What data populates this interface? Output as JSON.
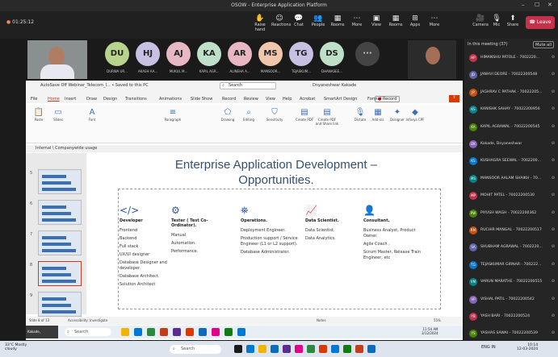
{
  "window": {
    "title": "OSOW - Enterprise Application Platform"
  },
  "meeting": {
    "timer": "01:25:12",
    "controls": [
      "Raise hand",
      "Reactions",
      "Chat",
      "People",
      "Rooms",
      "More",
      "View",
      "Rooms",
      "Apps",
      "More",
      "Camera",
      "Mic",
      "Share"
    ],
    "leave_label": "Leave"
  },
  "participants_strip": [
    {
      "initials": "DU",
      "name": "DURWA UR...",
      "color": "#b8d48c"
    },
    {
      "initials": "HJ",
      "name": "AKASH AA...",
      "color": "#c7c0e3"
    },
    {
      "initials": "AJ",
      "name": "MUKUL M...",
      "color": "#e7b7c4"
    },
    {
      "initials": "KA",
      "name": "KAPIL AGR...",
      "color": "#bfe0c8"
    },
    {
      "initials": "AR",
      "name": "ALINEHA A...",
      "color": "#e7b7c4"
    },
    {
      "initials": "MS",
      "name": "MANSOOR...",
      "color": "#f0c7ad"
    },
    {
      "initials": "TG",
      "name": "TEJASKUM...",
      "color": "#c7c0e3"
    },
    {
      "initials": "DS",
      "name": "DHANASEE...",
      "color": "#bfe0c8"
    }
  ],
  "ppt": {
    "titlebar": "AutoSave  Off   Webinar_Telecom_I... • Saved to this PC",
    "search": "Search",
    "user": "Dnyaneshwar Kakade",
    "menu": [
      "File",
      "Home",
      "Insert",
      "Draw",
      "Design",
      "Transitions",
      "Animations",
      "Slide Show",
      "Record",
      "Review",
      "View",
      "Help",
      "Acrobat",
      "SmartArt Design",
      "Format"
    ],
    "record_btn": "Record",
    "ribbon": [
      "Paste",
      "Slides",
      "Font",
      "Paragraph",
      "Drawing",
      "Editing",
      "Sensitivity",
      "Create PDF",
      "Create PDF and Share link",
      "Dictate",
      "Add-ins",
      "Designer",
      "Infosys CPF"
    ],
    "doctab": "Internal \\ Companywide usage",
    "slide_title": "Enterprise Application Development – Opportunities.",
    "columns": [
      {
        "header": "Developer",
        "icon": "code-icon",
        "items": [
          "Frontend",
          "Backend",
          "Full stack",
          "UX/UI designer",
          "Database Designer and developer.",
          "Database Architect.",
          "Solution Architect"
        ]
      },
      {
        "header": "Tester ( Test Co-Ordinator).",
        "icon": "gears-icon",
        "items": [
          "Manual",
          "Automation.",
          "Performance."
        ]
      },
      {
        "header": "Operations.",
        "icon": "ops-icon",
        "items": [
          "Deployment Engineer.",
          "Production support / Service Engineer (L1 or L2 support).",
          "Database Administrator."
        ]
      },
      {
        "header": "Data Scientist.",
        "icon": "chart-icon",
        "items": [
          "Data Scientist.",
          "Data Analytics."
        ]
      },
      {
        "header": "Consultant.",
        "icon": "person-icon",
        "items": [
          "Business Analyst, Product Owner.",
          "Agile Coach ,",
          "Scrum Master, Release Train Engineer, etc"
        ]
      }
    ],
    "thumb_numbers": [
      "5",
      "6",
      "7",
      "8",
      "9"
    ],
    "status_left": "Slide 8 of 13",
    "status_acc": "Accessibility: Investigate",
    "status_notes": "Notes",
    "zoom": "55%"
  },
  "people_panel": {
    "header": "In this meeting (37)",
    "mute_all": "Mute all",
    "list": [
      {
        "initials": "HP",
        "name": "HIMANSHU PATOLE - 7002220...",
        "color": "#c4314b"
      },
      {
        "initials": "JD",
        "name": "JANHVI DEORE - 70022200548",
        "color": "#6264a7"
      },
      {
        "initials": "JP",
        "name": "JAGHRAV C PATHAK - 70022205...",
        "color": "#ca5010"
      },
      {
        "initials": "KS",
        "name": "KANISHK SAHAY - 70022200956",
        "color": "#038387"
      },
      {
        "initials": "KA",
        "name": "KAPIL AGRAWAL - 70022200545",
        "color": "#498205"
      },
      {
        "initials": "DK",
        "name": "Kakade, Dnyaneshwar",
        "color": "#8764b8"
      },
      {
        "initials": "KS",
        "name": "KUSHAGRA SEEWAL - 7002200...",
        "color": "#0078d4"
      },
      {
        "initials": "MS",
        "name": "MANSOOR AALAM SHAIKH - 70...",
        "color": "#038387"
      },
      {
        "initials": "MP",
        "name": "MOHIT PATEL - 70022200530",
        "color": "#c4314b"
      },
      {
        "initials": "PW",
        "name": "PIYUSH WAGH - 70022200362",
        "color": "#498205"
      },
      {
        "initials": "RM",
        "name": "RUCHIR MANGAL - 70022200517",
        "color": "#ca5010"
      },
      {
        "initials": "SA",
        "name": "SHUBHAM AGRAWAL - 7002220...",
        "color": "#6264a7"
      },
      {
        "initials": "TG",
        "name": "TEJASKUMAR GIRNAR - 700222...",
        "color": "#0078d4"
      },
      {
        "initials": "VM",
        "name": "VARUN MARATHE - 70022200515",
        "color": "#038387"
      },
      {
        "initials": "VP",
        "name": "VISHAL PATIL - 70022200542",
        "color": "#8764b8"
      },
      {
        "initials": "YB",
        "name": "YASH BARI - 70022200524",
        "color": "#c4314b"
      },
      {
        "initials": "YS",
        "name": "YASHAS SAWAI - 70022200539",
        "color": "#498205"
      }
    ]
  },
  "taskbar": {
    "weather": "33°C Mostly cloudy",
    "search": "Search",
    "lang": "ENG IN",
    "time": "10:14",
    "date": "12-03-2024",
    "ppt_time": "11:54 AM",
    "ppt_date": "3/12/2024"
  },
  "presenter_tag": "Kakade, Dnyaneshwar"
}
